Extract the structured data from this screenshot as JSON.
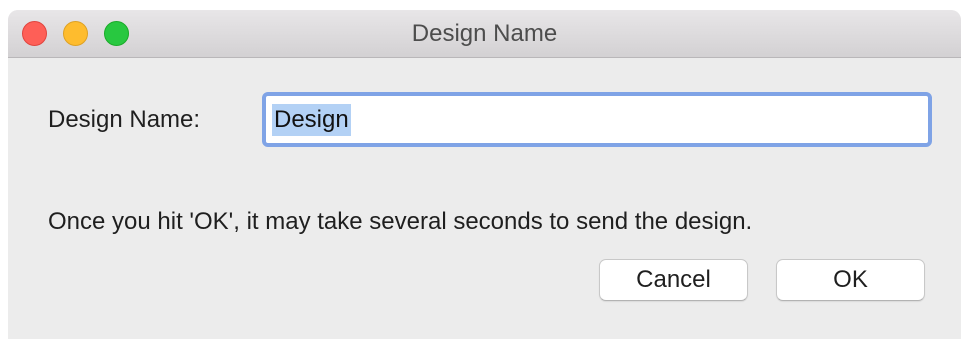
{
  "window": {
    "title": "Design Name"
  },
  "form": {
    "label": "Design Name:",
    "input_value": "Design",
    "input_selected": true
  },
  "message": "Once you hit 'OK', it may take several seconds to send the design.",
  "buttons": {
    "cancel_label": "Cancel",
    "ok_label": "OK"
  },
  "colors": {
    "close": "#fe5f57",
    "minimize": "#febc2e",
    "zoom": "#28c840",
    "focus_ring": "#7fa3e6",
    "selection": "#b3d1f5"
  }
}
